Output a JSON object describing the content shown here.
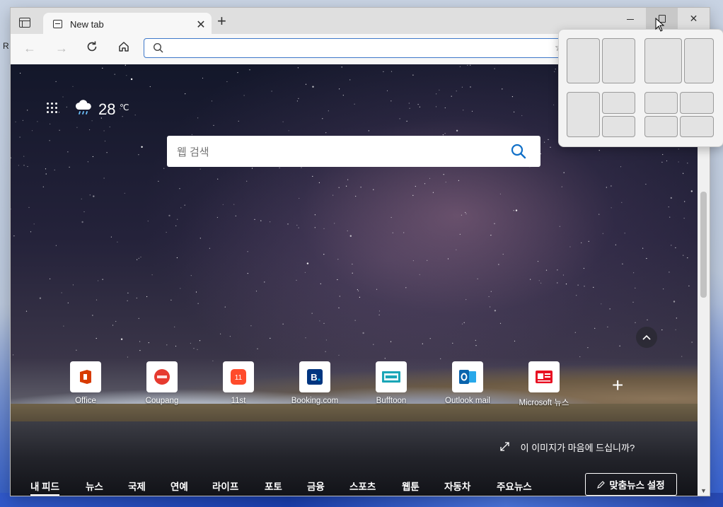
{
  "desktop": {
    "edge_letter": "R"
  },
  "browser": {
    "tab": {
      "title": "New tab",
      "close": "✕"
    },
    "new_tab": "+",
    "window_controls": {
      "close": "✕"
    },
    "toolbar": {
      "back": "←",
      "forward": "→",
      "address_value": ""
    }
  },
  "newtab": {
    "weather": {
      "temp": "28",
      "unit": "℃"
    },
    "search_placeholder": "웹 검색",
    "quick_links": [
      {
        "label": "Office",
        "color": "#d83b01"
      },
      {
        "label": "Coupang",
        "color": "#e63a2f"
      },
      {
        "label": "11st",
        "color": "#ff4b2b"
      },
      {
        "label": "Booking.com",
        "color": "#003580"
      },
      {
        "label": "Bufftoon",
        "color": "#1aa6b7"
      },
      {
        "label": "Outlook mail",
        "color": "#0a64ad"
      },
      {
        "label": "Microsoft 뉴스",
        "color": "#e81123"
      }
    ],
    "add_link": "+",
    "like_image": "이 이미지가 마음에 드십니까?",
    "feed_tabs": [
      "내 피드",
      "뉴스",
      "국제",
      "연예",
      "라이프",
      "포토",
      "금융",
      "스포츠",
      "웹툰",
      "자동차",
      "주요뉴스"
    ],
    "personalize": "맞춤뉴스 설정"
  }
}
